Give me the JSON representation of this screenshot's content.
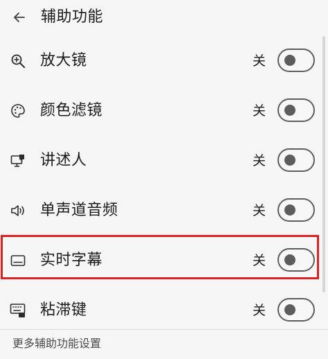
{
  "header": {
    "title": "辅助功能",
    "back_icon": "back-arrow-icon"
  },
  "settings": [
    {
      "label": "放大镜",
      "state": "关",
      "icon": "magnifier-icon",
      "enabled": false
    },
    {
      "label": "颜色滤镜",
      "state": "关",
      "icon": "color-filters-icon",
      "enabled": false
    },
    {
      "label": "讲述人",
      "state": "关",
      "icon": "narrator-icon",
      "enabled": false
    },
    {
      "label": "单声道音频",
      "state": "关",
      "icon": "mono-audio-icon",
      "enabled": false
    },
    {
      "label": "实时字幕",
      "state": "关",
      "icon": "live-captions-icon",
      "enabled": false,
      "highlighted": true
    },
    {
      "label": "粘滞键",
      "state": "关",
      "icon": "sticky-keys-icon",
      "enabled": false
    }
  ],
  "footer": {
    "link": "更多辅助功能设置"
  },
  "colors": {
    "background": "#f6f6f6",
    "text": "#1b1b1b",
    "toggle": "#5d5d5d",
    "highlight": "#e02020"
  }
}
